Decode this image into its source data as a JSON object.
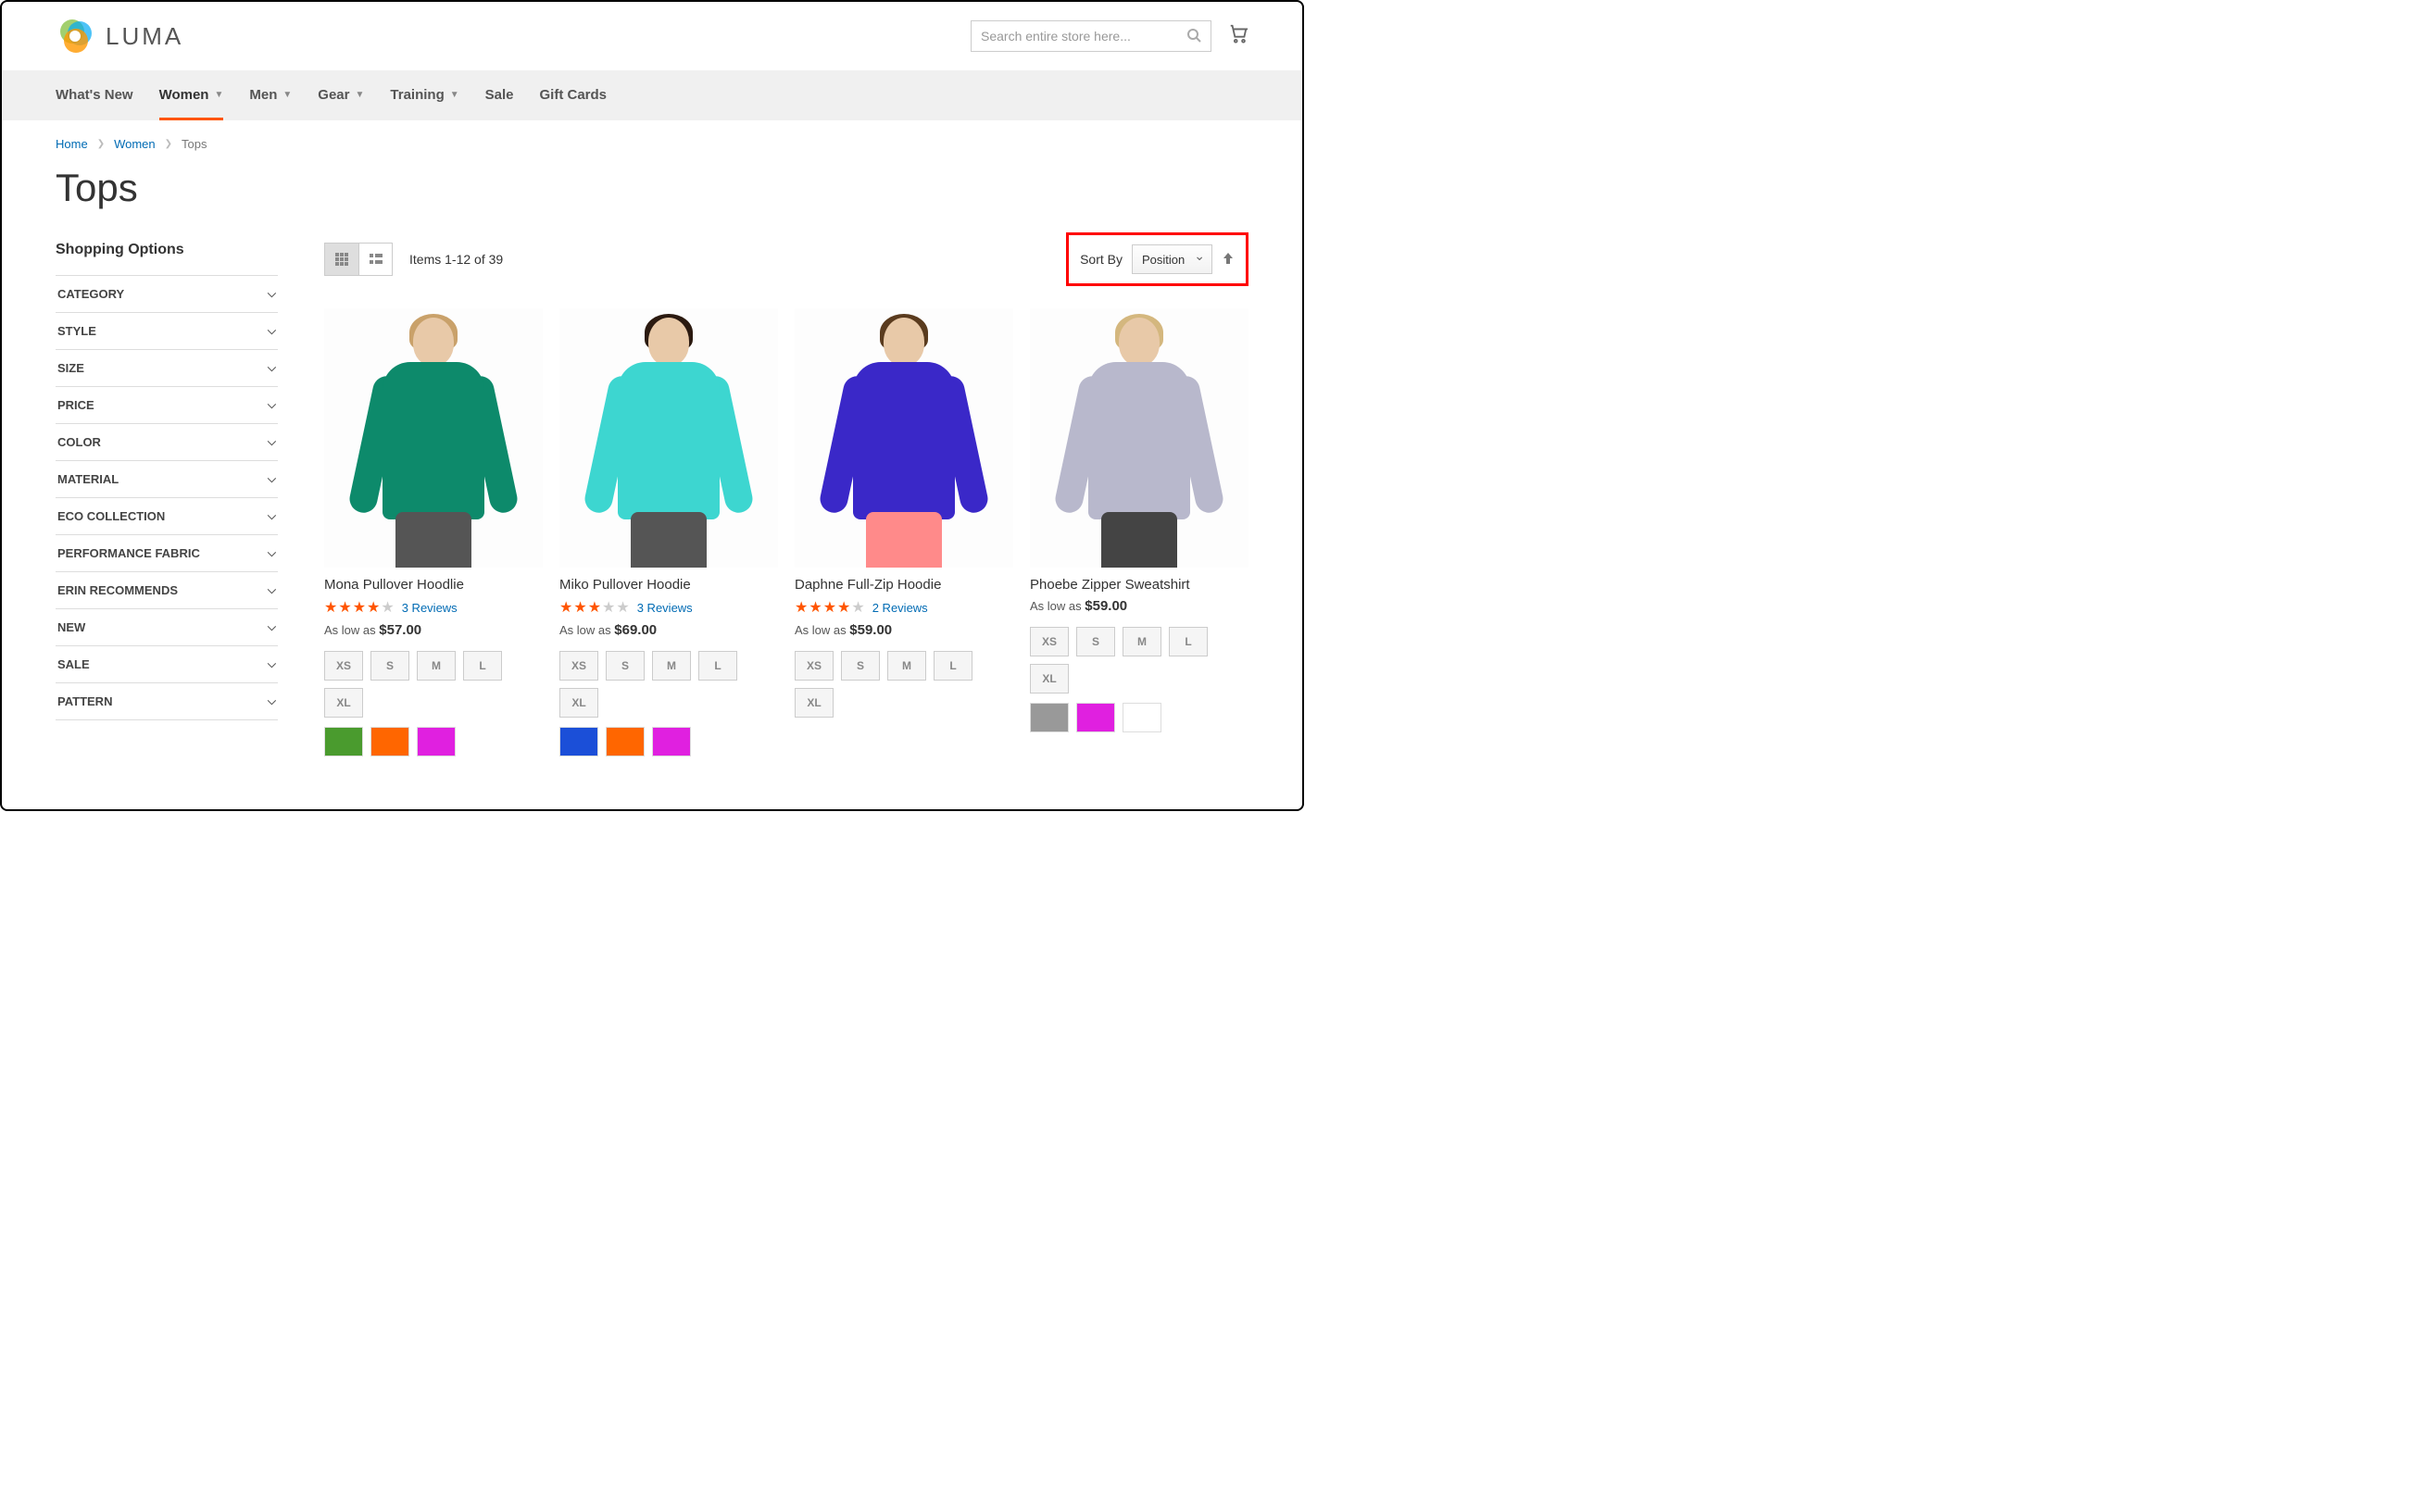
{
  "header": {
    "logo_text": "LUMA",
    "search_placeholder": "Search entire store here..."
  },
  "nav": {
    "items": [
      {
        "label": "What's New",
        "dropdown": false,
        "active": false
      },
      {
        "label": "Women",
        "dropdown": true,
        "active": true
      },
      {
        "label": "Men",
        "dropdown": true,
        "active": false
      },
      {
        "label": "Gear",
        "dropdown": true,
        "active": false
      },
      {
        "label": "Training",
        "dropdown": true,
        "active": false
      },
      {
        "label": "Sale",
        "dropdown": false,
        "active": false
      },
      {
        "label": "Gift Cards",
        "dropdown": false,
        "active": false
      }
    ]
  },
  "breadcrumb": {
    "items": [
      {
        "label": "Home",
        "link": true
      },
      {
        "label": "Women",
        "link": true
      },
      {
        "label": "Tops",
        "link": false
      }
    ]
  },
  "page_title": "Tops",
  "sidebar": {
    "title": "Shopping Options",
    "filters": [
      "CATEGORY",
      "STYLE",
      "SIZE",
      "PRICE",
      "COLOR",
      "MATERIAL",
      "ECO COLLECTION",
      "PERFORMANCE FABRIC",
      "ERIN RECOMMENDS",
      "NEW",
      "SALE",
      "PATTERN"
    ]
  },
  "toolbar": {
    "item_count": "Items 1-12 of 39",
    "sort_label": "Sort By",
    "sort_value": "Position"
  },
  "products": [
    {
      "name": "Mona Pullover Hoodlie",
      "rating": 4,
      "reviews": "3  Reviews",
      "price_prefix": "As low as",
      "price": "$57.00",
      "sizes": [
        "XS",
        "S",
        "M",
        "L",
        "XL"
      ],
      "colors": [
        "#4a9b2e",
        "#ff6600",
        "#e020e0"
      ],
      "shirt": "#0d8a6b",
      "hair": "#c9a16a",
      "legs": "#555"
    },
    {
      "name": "Miko Pullover Hoodie",
      "rating": 3,
      "reviews": "3  Reviews",
      "price_prefix": "As low as",
      "price": "$69.00",
      "sizes": [
        "XS",
        "S",
        "M",
        "L",
        "XL"
      ],
      "colors": [
        "#1b4fd8",
        "#ff6600",
        "#e020e0"
      ],
      "shirt": "#3dd6d0",
      "hair": "#2b1a10",
      "legs": "#555"
    },
    {
      "name": "Daphne Full-Zip Hoodie",
      "rating": 4,
      "reviews": "2  Reviews",
      "price_prefix": "As low as",
      "price": "$59.00",
      "sizes": [
        "XS",
        "S",
        "M",
        "L",
        "XL"
      ],
      "colors": [],
      "shirt": "#3a28c8",
      "hair": "#5a3b1e",
      "legs": "#ff8a8a"
    },
    {
      "name": "Phoebe Zipper Sweatshirt",
      "rating": 0,
      "reviews": "",
      "price_prefix": "As low as",
      "price": "$59.00",
      "sizes": [
        "XS",
        "S",
        "M",
        "L",
        "XL"
      ],
      "colors": [
        "#999999",
        "#e020e0",
        "#ffffff"
      ],
      "shirt": "#b8b8cc",
      "hair": "#d4b77e",
      "legs": "#444"
    }
  ]
}
